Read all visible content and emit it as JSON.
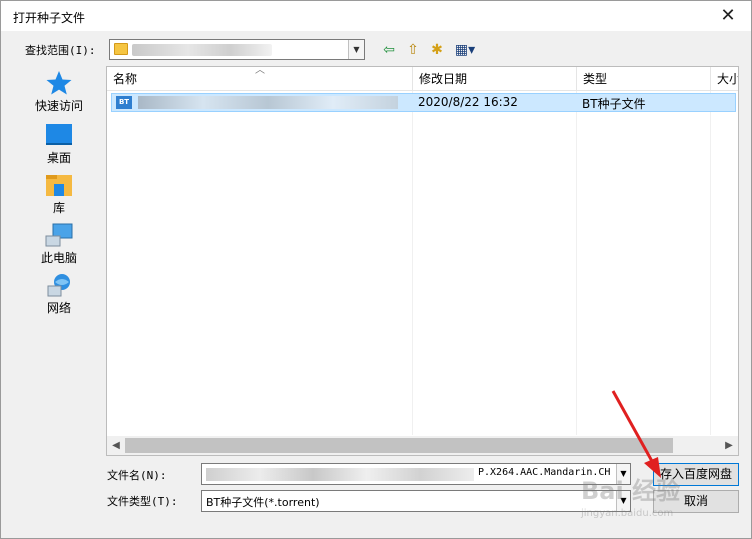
{
  "window": {
    "title": "打开种子文件",
    "close_glyph": "✕"
  },
  "lookin": {
    "label": "查找范围(I):",
    "value_blurred": true,
    "dropdown_glyph": "▼"
  },
  "toolbar": {
    "back": "⇦",
    "up": "⇧",
    "new_folder": "✱",
    "view": "▦▾"
  },
  "places": [
    {
      "label": "快速访问",
      "icon": "star-icon"
    },
    {
      "label": "桌面",
      "icon": "desktop-icon"
    },
    {
      "label": "库",
      "icon": "library-icon"
    },
    {
      "label": "此电脑",
      "icon": "computer-icon"
    },
    {
      "label": "网络",
      "icon": "network-icon"
    }
  ],
  "columns": [
    "名称",
    "修改日期",
    "类型",
    "大小"
  ],
  "files": [
    {
      "name_blurred": true,
      "date": "2020/8/22 16:32",
      "type": "BT种子文件",
      "icon_text": "BT"
    }
  ],
  "filename": {
    "label": "文件名(N):",
    "visible_value": "P.X264.AAC.Mandarin.CH"
  },
  "filetype": {
    "label": "文件类型(T):",
    "value": "BT种子文件(*.torrent)"
  },
  "buttons": {
    "open": "存入百度网盘",
    "cancel": "取消"
  },
  "watermark": {
    "brand": "Bai 经验",
    "url": "jingyan.baidu.com"
  },
  "colors": {
    "selection": "#cce8ff",
    "annotation_arrow": "#e02020"
  }
}
